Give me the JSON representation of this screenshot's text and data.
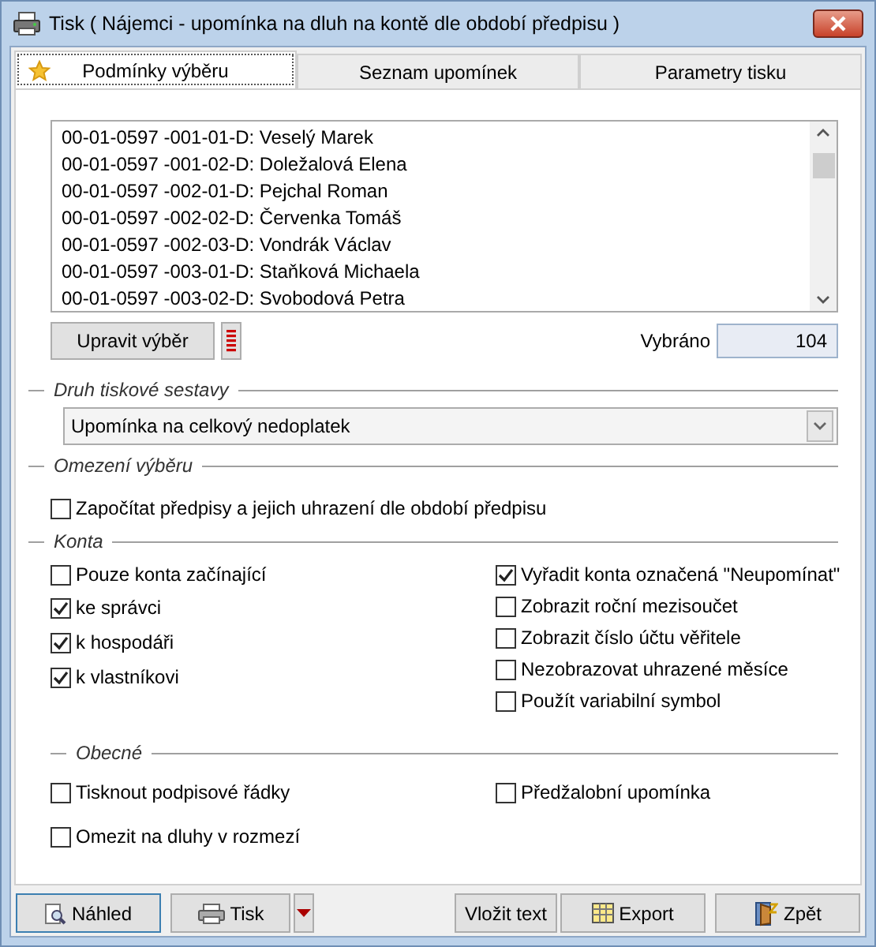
{
  "window": {
    "title": "Tisk ( Nájemci - upomínka na dluh na kontě dle období předpisu )"
  },
  "tabs": [
    {
      "label": "Podmínky výběru",
      "selected": true
    },
    {
      "label": "Seznam upomínek",
      "selected": false
    },
    {
      "label": "Parametry tisku",
      "selected": false
    }
  ],
  "accounts_list": [
    "00-01-0597 -001-01-D: Veselý Marek",
    "00-01-0597 -001-02-D: Doležalová Elena",
    "00-01-0597 -002-01-D: Pejchal Roman",
    "00-01-0597 -002-02-D: Červenka Tomáš",
    "00-01-0597 -002-03-D: Vondrák Václav",
    "00-01-0597 -003-01-D: Staňková Michaela",
    "00-01-0597 -003-02-D: Svobodová Petra"
  ],
  "edit_selection_button": "Upravit výběr",
  "selected_count": {
    "label": "Vybráno",
    "value": "104"
  },
  "report_type": {
    "title": "Druh tiskové sestavy",
    "value": "Upomínka na celkový nedoplatek"
  },
  "selection_limit": {
    "title": "Omezení výběru",
    "options": [
      {
        "label": "Započítat předpisy a jejich uhrazení dle období předpisu",
        "checked": false
      }
    ]
  },
  "accounts": {
    "title": "Konta",
    "left": [
      {
        "label": "Pouze konta začínající",
        "checked": false
      },
      {
        "label": "ke správci",
        "checked": true
      },
      {
        "label": "k hospodáři",
        "checked": true
      },
      {
        "label": "k vlastníkovi",
        "checked": true
      }
    ],
    "right": [
      {
        "label": "Vyřadit konta označená \"Neupomínat\"",
        "checked": true
      },
      {
        "label": "Zobrazit roční mezisoučet",
        "checked": false
      },
      {
        "label": "Zobrazit číslo účtu věřitele",
        "checked": false
      },
      {
        "label": "Nezobrazovat uhrazené měsíce",
        "checked": false
      },
      {
        "label": "Použít variabilní symbol",
        "checked": false
      }
    ]
  },
  "general": {
    "title": "Obecné",
    "left": [
      {
        "label": "Tisknout podpisové řádky",
        "checked": false
      },
      {
        "label": "Omezit na dluhy v rozmezí",
        "checked": false
      }
    ],
    "right": [
      {
        "label": "Předžalobní upomínka",
        "checked": false
      }
    ]
  },
  "buttons": {
    "preview": "Náhled",
    "print": "Tisk",
    "insert_text": "Vložit text",
    "export": "Export",
    "back": "Zpět"
  }
}
